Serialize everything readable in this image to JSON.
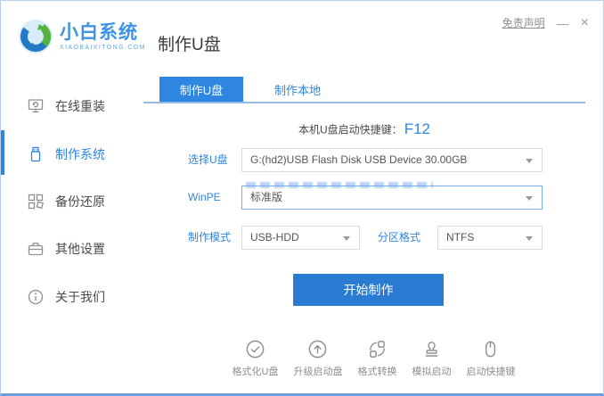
{
  "window": {
    "disclaimer": "免责声明",
    "minimize": "—",
    "close": "×"
  },
  "header": {
    "logo_title": "小白系统",
    "logo_subtitle": "XIAOBAIXITONG.COM",
    "page_title": "制作U盘"
  },
  "sidebar": {
    "items": [
      {
        "label": "在线重装",
        "icon": "monitor-reinstall-icon",
        "active": false
      },
      {
        "label": "制作系统",
        "icon": "usb-drive-icon",
        "active": true
      },
      {
        "label": "备份还原",
        "icon": "backup-grid-icon",
        "active": false
      },
      {
        "label": "其他设置",
        "icon": "briefcase-icon",
        "active": false
      },
      {
        "label": "关于我们",
        "icon": "info-circle-icon",
        "active": false
      }
    ]
  },
  "tabs": [
    {
      "label": "制作U盘",
      "active": true
    },
    {
      "label": "制作本地",
      "active": false
    }
  ],
  "main": {
    "hotkey_label": "本机U盘启动快捷键：",
    "hotkey_value": "F12",
    "form": {
      "usb_label": "选择U盘",
      "usb_value": "G:(hd2)USB Flash Disk USB Device 30.00GB",
      "winpe_label": "WinPE",
      "winpe_value": "标准版",
      "mode_label": "制作模式",
      "mode_value": "USB-HDD",
      "partition_label": "分区格式",
      "partition_value": "NTFS"
    },
    "start_button": "开始制作",
    "toolbar": [
      {
        "label": "格式化U盘",
        "icon": "check-circle-icon"
      },
      {
        "label": "升级启动盘",
        "icon": "arrow-up-circle-icon"
      },
      {
        "label": "格式转换",
        "icon": "convert-icon"
      },
      {
        "label": "模拟启动",
        "icon": "stamp-icon"
      },
      {
        "label": "启动快捷键",
        "icon": "mouse-icon"
      }
    ]
  },
  "colors": {
    "accent": "#2e86e0",
    "button_blue": "#2a7bd2",
    "tab_underline": "#93bce9",
    "window_border_bottom": "#6b9cd9"
  }
}
